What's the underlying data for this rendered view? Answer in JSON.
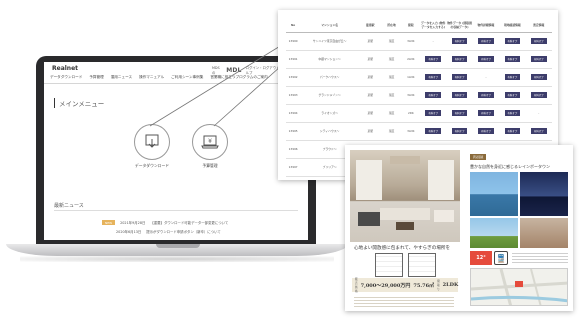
{
  "app": {
    "logo": "Realnet",
    "nav": [
      "データダウンロード",
      "予算管理",
      "運用ニュース",
      "操作マニュアル",
      "ご利用シーン事例集",
      "営業職に役立つプログラムのご案内"
    ],
    "utils_left": "MDSの",
    "utils_brand": "MDL",
    "utils_sub": "ログイン・ログアウト・オプション・ヘルプ"
  },
  "main": {
    "title": "メインメニュー",
    "menu": [
      {
        "label": "データダウンロード",
        "icon": "download-icon"
      },
      {
        "label": "予算管理",
        "icon": "laptop-yen-icon"
      }
    ]
  },
  "news": {
    "title": "最新ニュース",
    "items": [
      {
        "badge": "NEW",
        "date": "2021年9月28日",
        "text": "【重要】ダウンロード可能データ一部変更について"
      },
      {
        "badge": "",
        "date": "2020年6月13日",
        "text": "提示がダウンロード申請ボタン（新卒）について"
      }
    ]
  },
  "table": {
    "headers": [
      "No",
      "マンション名",
      "最寄駅",
      "所在地",
      "間取",
      "データを入力 (物件データを入力する)",
      "物件データ (間取図の収納データ)",
      "物件詳細情報",
      "現地確認情報",
      "査定情報"
    ],
    "rows": [
      {
        "no": "13990",
        "name": "サンハイツ東京自由が丘〜",
        "station": "某駅",
        "area": "某区",
        "plan": "3LDK",
        "cols": [
          "-",
          "有料オプ",
          "有料オプ",
          "有料オプ",
          "有料オプ"
        ]
      },
      {
        "no": "13991",
        "name": "中銀マンション〜",
        "station": "某駅",
        "area": "某区",
        "plan": "2LDK",
        "cols": [
          "有料オプ",
          "有料オプ",
          "有料オプ",
          "有料オプ",
          "有料オプ"
        ]
      },
      {
        "no": "13992",
        "name": "パークハウス〜",
        "station": "某駅",
        "area": "某区",
        "plan": "1LDK",
        "cols": [
          "有料オプ",
          "有料オプ",
          "-",
          "有料オプ",
          "有料オプ"
        ]
      },
      {
        "no": "13993",
        "name": "グランドメゾン〜",
        "station": "某駅",
        "area": "某区",
        "plan": "3LDK",
        "cols": [
          "有料オプ",
          "有料オプ",
          "有料オプ",
          "有料オプ",
          "有料オプ"
        ]
      },
      {
        "no": "13994",
        "name": "ライオンズ〜",
        "station": "某駅",
        "area": "某区",
        "plan": "2DK",
        "cols": [
          "有料オプ",
          "有料オプ",
          "有料オプ",
          "有料オプ",
          "-"
        ]
      },
      {
        "no": "13995",
        "name": "シティハウス〜",
        "station": "某駅",
        "area": "某区",
        "plan": "3LDK",
        "cols": [
          "有料オプ",
          "有料オプ",
          "有料オプ",
          "有料オプ",
          "有料オプ"
        ]
      },
      {
        "no": "13996",
        "name": "プラウド〜",
        "station": "某駅",
        "area": "某区",
        "plan": "2LDK",
        "cols": [
          "有料オプ",
          "有料オプ",
          "有料オプ",
          "有料オプ",
          "有料オプ"
        ]
      },
      {
        "no": "13997",
        "name": "ブリリア〜",
        "station": "某駅",
        "area": "某区",
        "plan": "1K",
        "cols": [
          "有料オプ",
          "有料オプ",
          "有料オプ",
          "有料オプ",
          "有料オプ"
        ]
      },
      {
        "no": "13998",
        "name": "パークタワー〜",
        "station": "某駅",
        "area": "某区",
        "plan": "3LDK",
        "cols": [
          "有料オプ",
          "有料オプ",
          "有料オプ",
          "有料オプ",
          "有料オプ"
        ]
      }
    ]
  },
  "flyer": {
    "catch": "心地よい開放感に包まれて、やすらぎの場所を",
    "price_label": "販売価格",
    "price": "7,000〜29,000万円",
    "area": "75.76㎡",
    "layout_label": "間取り",
    "layout": "2LDK",
    "right_tag": "周辺環境",
    "right_headline": "豊かな自然を身近に感じるレインボータウン",
    "temp": "12°"
  }
}
